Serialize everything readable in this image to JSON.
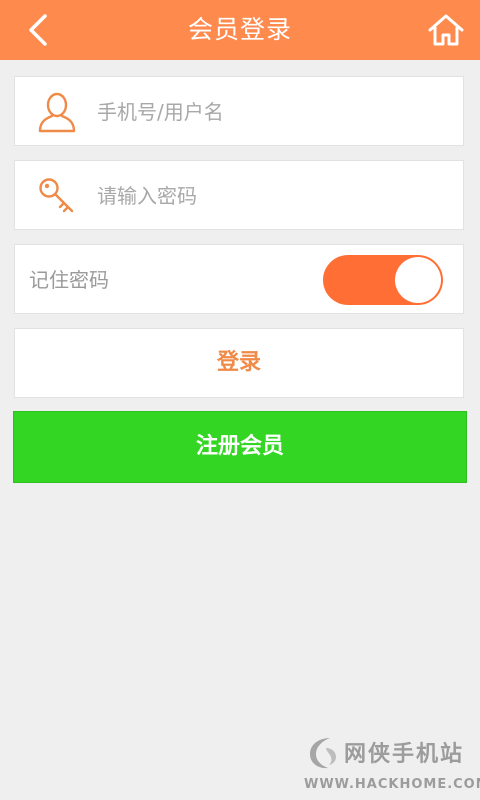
{
  "header": {
    "title": "会员登录",
    "back_icon": "chevron-left-icon",
    "home_icon": "home-icon",
    "color": "#ff8a4d"
  },
  "form": {
    "username": {
      "icon": "user-icon",
      "placeholder": "手机号/用户名",
      "value": ""
    },
    "password": {
      "icon": "key-icon",
      "placeholder": "请输入密码",
      "value": ""
    },
    "remember": {
      "label": "记住密码",
      "enabled": true,
      "color": "#ff6f35"
    }
  },
  "actions": {
    "login_label": "登录",
    "login_color": "#f08a48",
    "register_label": "注册会员",
    "register_color": "#33d623"
  },
  "watermark": {
    "name": "网侠手机站",
    "url": "WWW.HACKHOME.COM"
  }
}
